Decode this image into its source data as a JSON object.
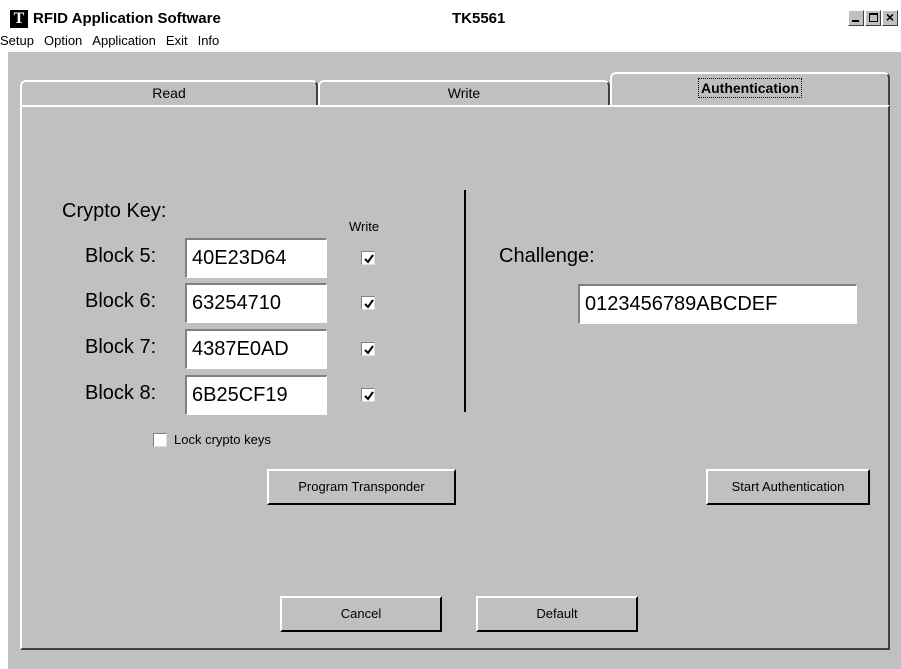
{
  "window": {
    "app_icon_letter": "T",
    "title": "RFID Application Software",
    "model": "TK5561",
    "close_glyph": "×"
  },
  "menu": [
    "Setup",
    "Option",
    "Application",
    "Exit",
    "Info"
  ],
  "tabs": [
    {
      "label": "Read",
      "active": false
    },
    {
      "label": "Write",
      "active": false
    },
    {
      "label": "Authentication",
      "active": true
    }
  ],
  "crypto": {
    "heading": "Crypto Key:",
    "write_column_label": "Write",
    "blocks": [
      {
        "label": "Block 5:",
        "value": "40E23D64",
        "write_checked": true
      },
      {
        "label": "Block 6:",
        "value": "63254710",
        "write_checked": true
      },
      {
        "label": "Block 7:",
        "value": "4387E0AD",
        "write_checked": true
      },
      {
        "label": "Block 8:",
        "value": "6B25CF19",
        "write_checked": true
      }
    ],
    "lock_label": "Lock crypto keys",
    "lock_checked": false
  },
  "challenge": {
    "label": "Challenge:",
    "value": "0123456789ABCDEF"
  },
  "buttons": {
    "program": "Program Transponder",
    "start_auth": "Start Authentication",
    "cancel": "Cancel",
    "default": "Default"
  }
}
